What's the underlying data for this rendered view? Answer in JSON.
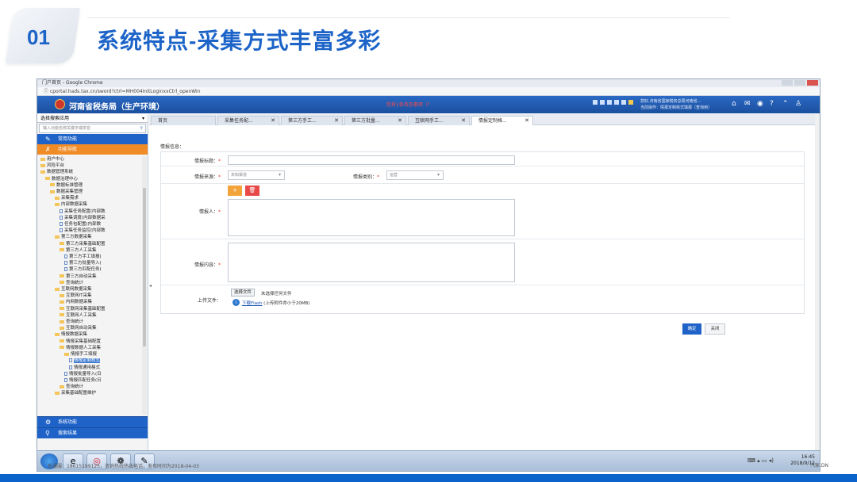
{
  "slide": {
    "number": "01",
    "title": "系统特点-采集方式丰富多彩"
  },
  "browser": {
    "window_title": "门户首页 - Google Chrome",
    "url": "cportal.hads.tax.cn/sword?ctrl=MH004InitLoginxxCtrl_openWin"
  },
  "site": {
    "name": "河南省税务局（生产环境）",
    "alert": "您有1条待办事项（！",
    "user_line1": "您好,河南省国家税务总局河南省...",
    "user_line2": "当前操作：情报定制核式填报（查询用）"
  },
  "sidebar": {
    "select_label": "选择搜索应用",
    "search_placeholder": "输入功能名称关键字或拼音",
    "common_label": "常用功能",
    "nav_label": "功能导航",
    "tree": [
      {
        "label": "用户中心",
        "level": 1,
        "type": "folder"
      },
      {
        "label": "风险平台",
        "level": 1,
        "type": "folder"
      },
      {
        "label": "数据管理系统",
        "level": 1,
        "type": "folder"
      },
      {
        "label": "数据治理中心",
        "level": 2,
        "type": "folder"
      },
      {
        "label": "数据标准管理",
        "level": 3,
        "type": "folder"
      },
      {
        "label": "数据采集管理",
        "level": 3,
        "type": "folder"
      },
      {
        "label": "采集需求",
        "level": 4,
        "type": "folder"
      },
      {
        "label": "内部数据采集",
        "level": 4,
        "type": "folder"
      },
      {
        "label": "采集任务配置(内部数",
        "level": 5,
        "type": "file"
      },
      {
        "label": "采集调度(内部数据采",
        "level": 5,
        "type": "file"
      },
      {
        "label": "任务包配置(内部数",
        "level": 5,
        "type": "file"
      },
      {
        "label": "采集任务监控(内部数",
        "level": 5,
        "type": "file"
      },
      {
        "label": "第三方数据采集",
        "level": 4,
        "type": "folder"
      },
      {
        "label": "第三方采集基础配置",
        "level": 5,
        "type": "folder"
      },
      {
        "label": "第三方人工采集",
        "level": 5,
        "type": "folder"
      },
      {
        "label": "第三方手工填报(",
        "level": 6,
        "type": "file"
      },
      {
        "label": "第三方批量导入(",
        "level": 6,
        "type": "file"
      },
      {
        "label": "第三方匹配任务(",
        "level": 6,
        "type": "file"
      },
      {
        "label": "第三方自动采集",
        "level": 5,
        "type": "folder"
      },
      {
        "label": "查询统计",
        "level": 5,
        "type": "folder"
      },
      {
        "label": "互联网数据采集",
        "level": 4,
        "type": "folder"
      },
      {
        "label": "互联网IT采集",
        "level": 5,
        "type": "folder"
      },
      {
        "label": "内网数据采集",
        "level": 5,
        "type": "folder"
      },
      {
        "label": "互联网采集基础配置",
        "level": 5,
        "type": "folder"
      },
      {
        "label": "互联网人工采集",
        "level": 5,
        "type": "folder"
      },
      {
        "label": "查询统计",
        "level": 5,
        "type": "folder"
      },
      {
        "label": "互联网自动采集",
        "level": 5,
        "type": "folder"
      },
      {
        "label": "情报数据采集",
        "level": 4,
        "type": "folder"
      },
      {
        "label": "情报采集基础配置",
        "level": 5,
        "type": "folder"
      },
      {
        "label": "情报数据人工采集",
        "level": 5,
        "type": "folder"
      },
      {
        "label": "情报手工填报",
        "level": 6,
        "type": "folder"
      },
      {
        "label": "情报定制核式",
        "level": 7,
        "type": "file",
        "selected": true
      },
      {
        "label": "情报通用格式",
        "level": 7,
        "type": "file"
      },
      {
        "label": "情报批量导入(日",
        "level": 6,
        "type": "file"
      },
      {
        "label": "情报匹配任务(日",
        "level": 6,
        "type": "file"
      },
      {
        "label": "查询统计",
        "level": 5,
        "type": "folder"
      },
      {
        "label": "采集基础配置维护",
        "level": 4,
        "type": "folder"
      }
    ],
    "system_label": "系统功能",
    "search_result_label": "搜索结果"
  },
  "tabs": [
    {
      "label": "首页",
      "closable": false
    },
    {
      "label": "采集任务配...",
      "closable": true
    },
    {
      "label": "第三方手工...",
      "closable": true
    },
    {
      "label": "第三方批量...",
      "closable": true
    },
    {
      "label": "互联网手工...",
      "closable": true
    },
    {
      "label": "情报定制格...",
      "closable": true,
      "active": true
    }
  ],
  "form": {
    "section_title": "情报信息：",
    "title_label": "情报标题：",
    "source_label": "情报来源：",
    "source_value": "未知渠道",
    "category_label": "情报类别：",
    "category_value": "运营",
    "person_label": "情报人：",
    "add_symbol": "+",
    "delete_symbol": "🗑",
    "content_label": "情报内容：",
    "upload_label": "上传文件：",
    "choose_file": "选择文件",
    "no_file": "未选择任何文件",
    "flash_link": "下载Flash",
    "upload_hint": "(上传附件命小于20MB)",
    "confirm": "确定",
    "close": "关闭"
  },
  "taskbar": {
    "time": "16:45",
    "date": "2018/9/12"
  },
  "footer": {
    "left": "系通服：18615199125，咨询热线热线电话，发布时间为2018-04-03",
    "right": "汽家.DN"
  }
}
